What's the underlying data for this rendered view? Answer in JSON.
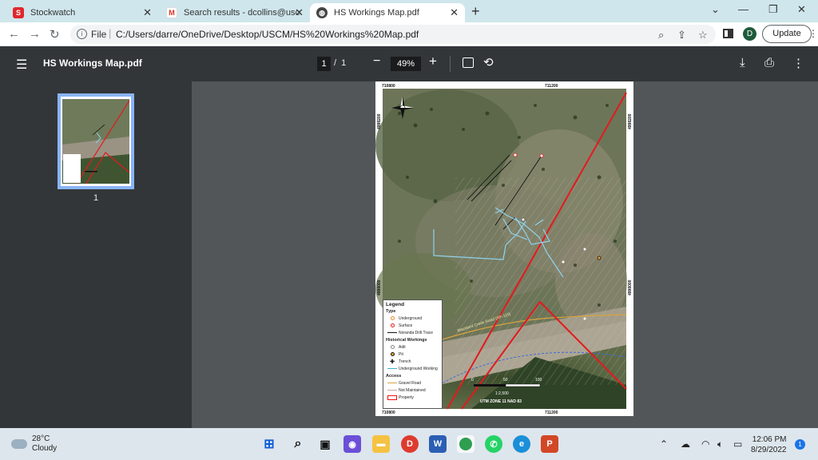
{
  "tabs": [
    {
      "label": "Stockwatch",
      "icon": "stockwatch-icon"
    },
    {
      "label": "Search results - dcollins@uscmc",
      "icon": "gmail-icon"
    },
    {
      "label": "HS Workings Map.pdf",
      "icon": "globe-icon",
      "active": true
    }
  ],
  "address": {
    "scheme": "File",
    "url": "C:/Users/darre/OneDrive/Desktop/USCM/HS%20Workings%20Map.pdf"
  },
  "profile_initial": "D",
  "update_label": "Update",
  "viewer": {
    "title": "HS Workings Map.pdf",
    "page_current": "1",
    "page_total": "1",
    "zoom": "49%",
    "thumb_page_number": "1"
  },
  "map": {
    "coords_top": [
      "710800",
      "711200"
    ],
    "coords_bottom": [
      "710800",
      "711200"
    ],
    "coords_left": [
      "4998200",
      "4998000"
    ],
    "coords_right": [
      "4998200",
      "4998000"
    ],
    "road_label": "Blackbird Creek Road (NF-115)",
    "scale_labels": [
      "0",
      "50",
      "100"
    ],
    "scale_text": "1:2,500",
    "utm_text": "UTM ZONE 11 NAD 83",
    "legend": {
      "title": "Legend",
      "type_heading": "Type",
      "type_items": [
        "Underground",
        "Surface",
        "Noranda Drill Trace"
      ],
      "hist_heading": "Historical Workings",
      "hist_items": [
        "Adit",
        "Pit",
        "Trench",
        "Underground Working"
      ],
      "access_heading": "Access",
      "access_items": [
        "Gravel Road",
        "Not Maintained",
        "Property"
      ]
    },
    "colors": {
      "property": "#e31a1c",
      "underground_working": "#8fd3f0",
      "gravel_road": "#d9a441",
      "drill_trace": "#111111"
    }
  },
  "taskbar": {
    "temperature": "28°C",
    "condition": "Cloudy",
    "time": "12:06 PM",
    "date": "8/29/2022",
    "notifications": "1"
  }
}
